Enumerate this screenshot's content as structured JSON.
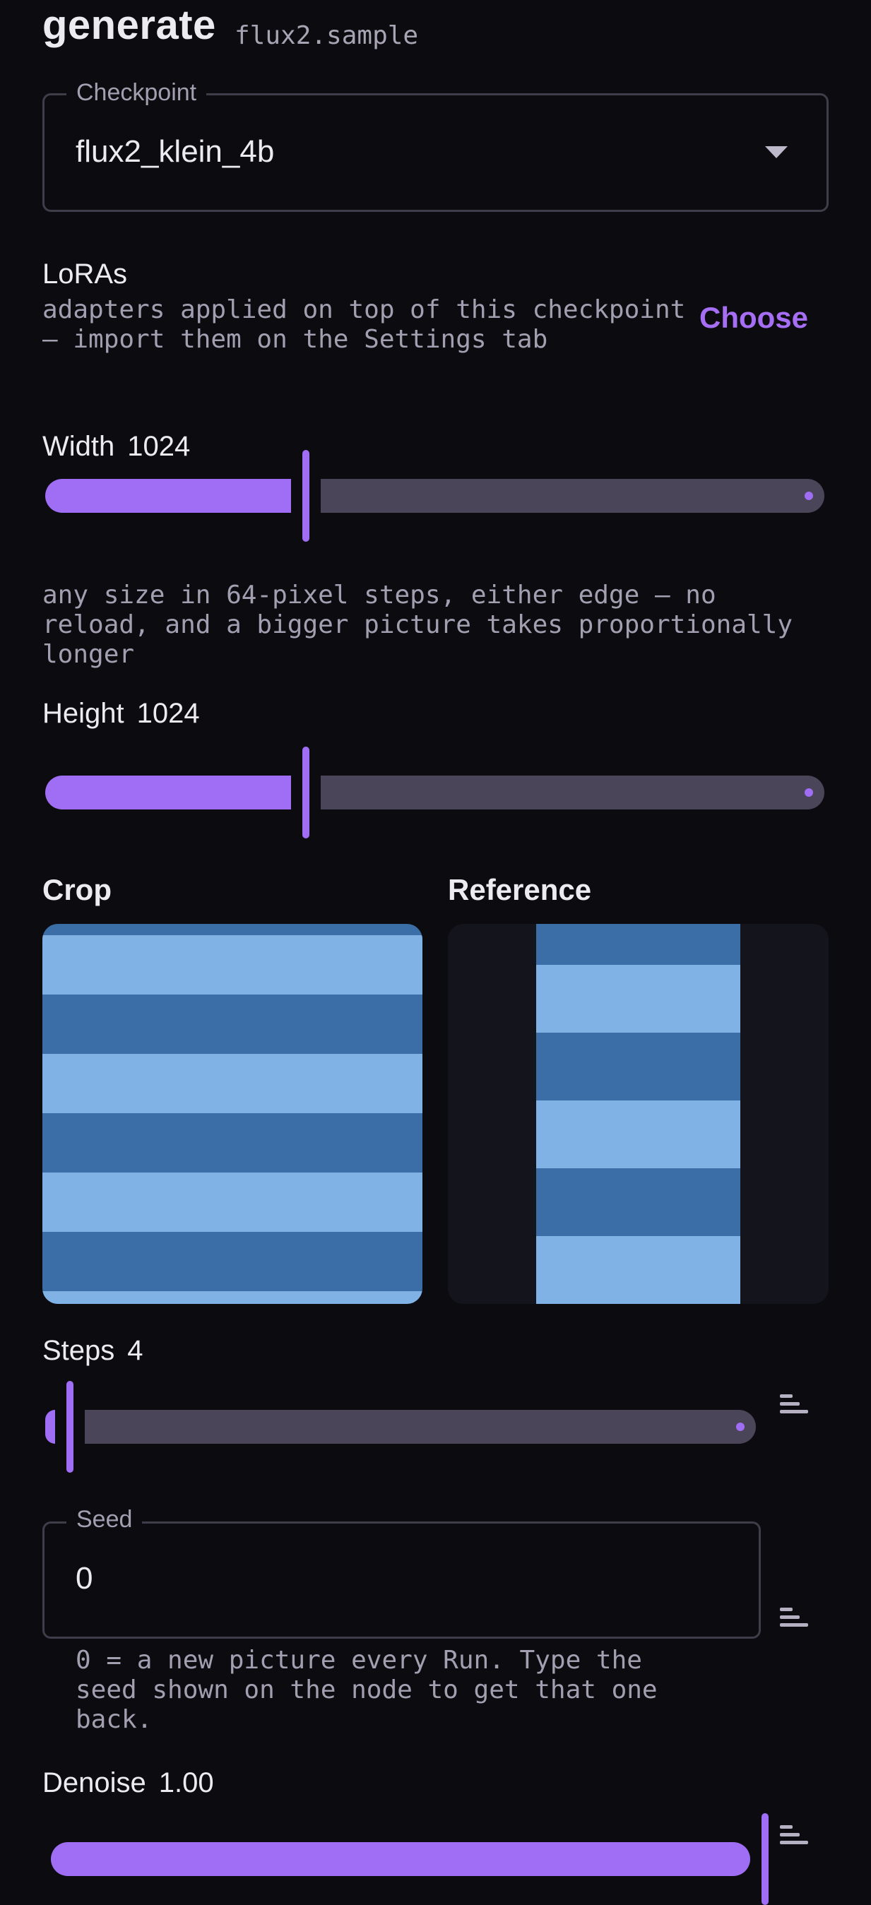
{
  "header": {
    "title": "generate",
    "subtitle": "flux2.sample"
  },
  "checkpoint": {
    "label": "Checkpoint",
    "value": "flux2_klein_4b",
    "caret_icon": "caret-down-icon"
  },
  "loras": {
    "label": "LoRAs",
    "description": "adapters applied on top of this checkpoint — import them on the Settings tab",
    "choose_label": "Choose"
  },
  "width": {
    "label": "Width",
    "value": "1024",
    "fraction": 0.33,
    "help": "any size in 64-pixel steps, either edge — no reload, and a bigger picture takes proportionally longer"
  },
  "height": {
    "label": "Height",
    "value": "1024",
    "fraction": 0.33
  },
  "crop": {
    "title": "Crop"
  },
  "reference": {
    "title": "Reference"
  },
  "steps": {
    "label": "Steps",
    "value": "4",
    "fraction": 0.03
  },
  "seed": {
    "label": "Seed",
    "value": "0",
    "help": "0 = a new picture every Run. Type the seed shown on the node to get that one back."
  },
  "denoise": {
    "label": "Denoise",
    "value": "1.00",
    "fraction": 1.0
  },
  "colors": {
    "accent": "#a06ef4",
    "track": "#4b4559",
    "background": "#0c0c10",
    "stripe_light": "#80b2e5",
    "stripe_dark": "#3b6ea7"
  }
}
